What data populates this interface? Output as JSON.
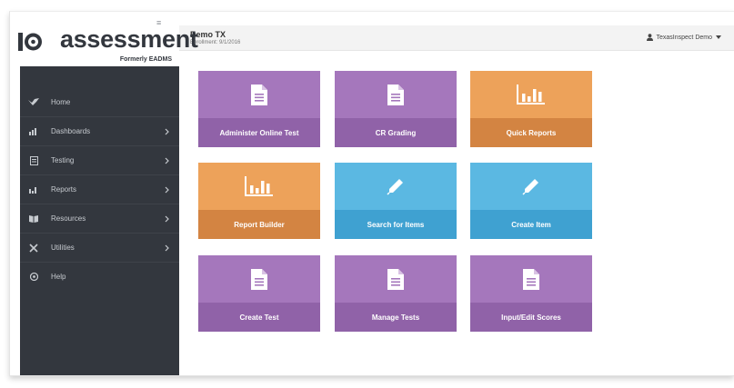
{
  "header": {
    "site_name": "Demo TX",
    "site_sub": "Enrollment: 9/1/2016",
    "user_name": "TexasInspect Demo"
  },
  "sidebar": {
    "logo_text": "assessment",
    "logo_sub": "Formerly EADMS",
    "items": [
      {
        "label": "Home",
        "icon": "bird-icon",
        "has_chevron": false
      },
      {
        "label": "Dashboards",
        "icon": "dashboard-icon",
        "has_chevron": true
      },
      {
        "label": "Testing",
        "icon": "testing-icon",
        "has_chevron": true
      },
      {
        "label": "Reports",
        "icon": "bar-chart-icon",
        "has_chevron": true
      },
      {
        "label": "Resources",
        "icon": "book-icon",
        "has_chevron": true
      },
      {
        "label": "Utilities",
        "icon": "tools-icon",
        "has_chevron": true
      },
      {
        "label": "Help",
        "icon": "help-icon",
        "has_chevron": false
      }
    ]
  },
  "tiles": [
    {
      "label": "Administer Online Test",
      "icon": "document-icon",
      "color": "purple"
    },
    {
      "label": "CR Grading",
      "icon": "document-icon",
      "color": "purple"
    },
    {
      "label": "Quick Reports",
      "icon": "bar-chart-icon",
      "color": "orange"
    },
    {
      "label": "Report Builder",
      "icon": "bar-chart-icon",
      "color": "orange"
    },
    {
      "label": "Search for Items",
      "icon": "pencil-icon",
      "color": "blue"
    },
    {
      "label": "Create Item",
      "icon": "pencil-icon",
      "color": "blue"
    },
    {
      "label": "Create Test",
      "icon": "document-icon",
      "color": "purple"
    },
    {
      "label": "Manage Tests",
      "icon": "document-icon",
      "color": "purple"
    },
    {
      "label": "Input/Edit Scores",
      "icon": "document-icon",
      "color": "purple"
    }
  ],
  "colors": {
    "sidebar_bg": "#33373e",
    "purple_top": "#a577bc",
    "purple_bottom": "#9062a8",
    "orange_top": "#eda25a",
    "orange_bottom": "#d38442",
    "blue_top": "#5bb8e2",
    "blue_bottom": "#3fa1d1"
  }
}
